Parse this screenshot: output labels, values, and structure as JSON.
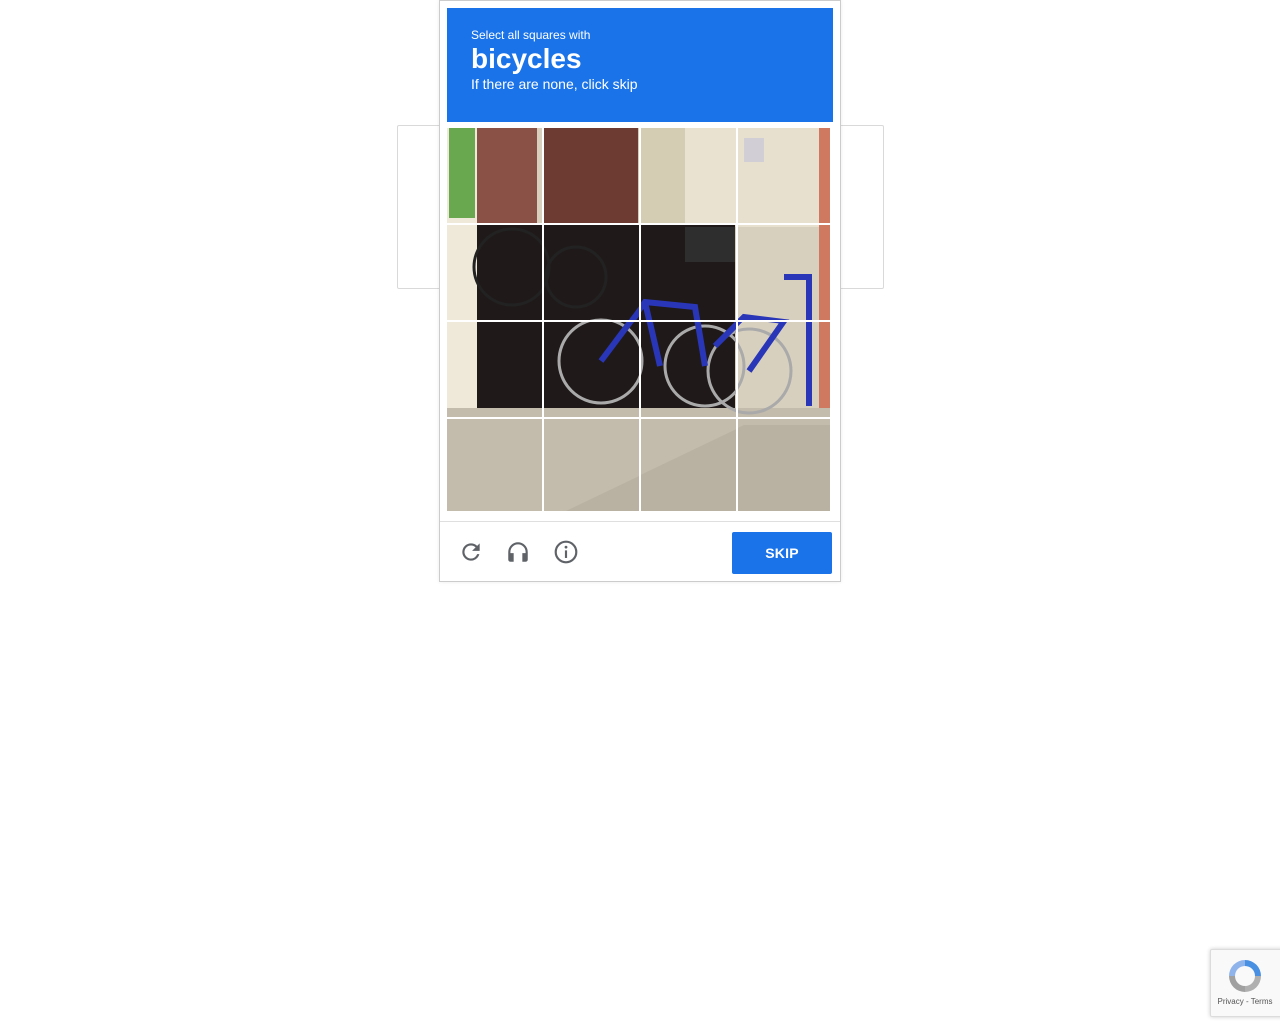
{
  "challenge": {
    "instruction_line1": "Select all squares with",
    "target_object": "bicycles",
    "instruction_line3": "If there are none, click skip",
    "grid": {
      "rows": 4,
      "cols": 4,
      "tiles": [
        {
          "row": 0,
          "col": 0
        },
        {
          "row": 0,
          "col": 1
        },
        {
          "row": 0,
          "col": 2
        },
        {
          "row": 0,
          "col": 3
        },
        {
          "row": 1,
          "col": 0
        },
        {
          "row": 1,
          "col": 1
        },
        {
          "row": 1,
          "col": 2
        },
        {
          "row": 1,
          "col": 3
        },
        {
          "row": 2,
          "col": 0
        },
        {
          "row": 2,
          "col": 1
        },
        {
          "row": 2,
          "col": 2
        },
        {
          "row": 2,
          "col": 3
        },
        {
          "row": 3,
          "col": 0
        },
        {
          "row": 3,
          "col": 1
        },
        {
          "row": 3,
          "col": 2
        },
        {
          "row": 3,
          "col": 3
        }
      ]
    },
    "footer": {
      "reload_icon": "reload-icon",
      "audio_icon": "headphones-icon",
      "info_icon": "info-icon",
      "skip_label": "SKIP"
    }
  },
  "badge": {
    "privacy_label": "Privacy",
    "separator": " - ",
    "terms_label": "Terms"
  },
  "colors": {
    "accent": "#1a73e8",
    "icon_gray": "#555555"
  }
}
